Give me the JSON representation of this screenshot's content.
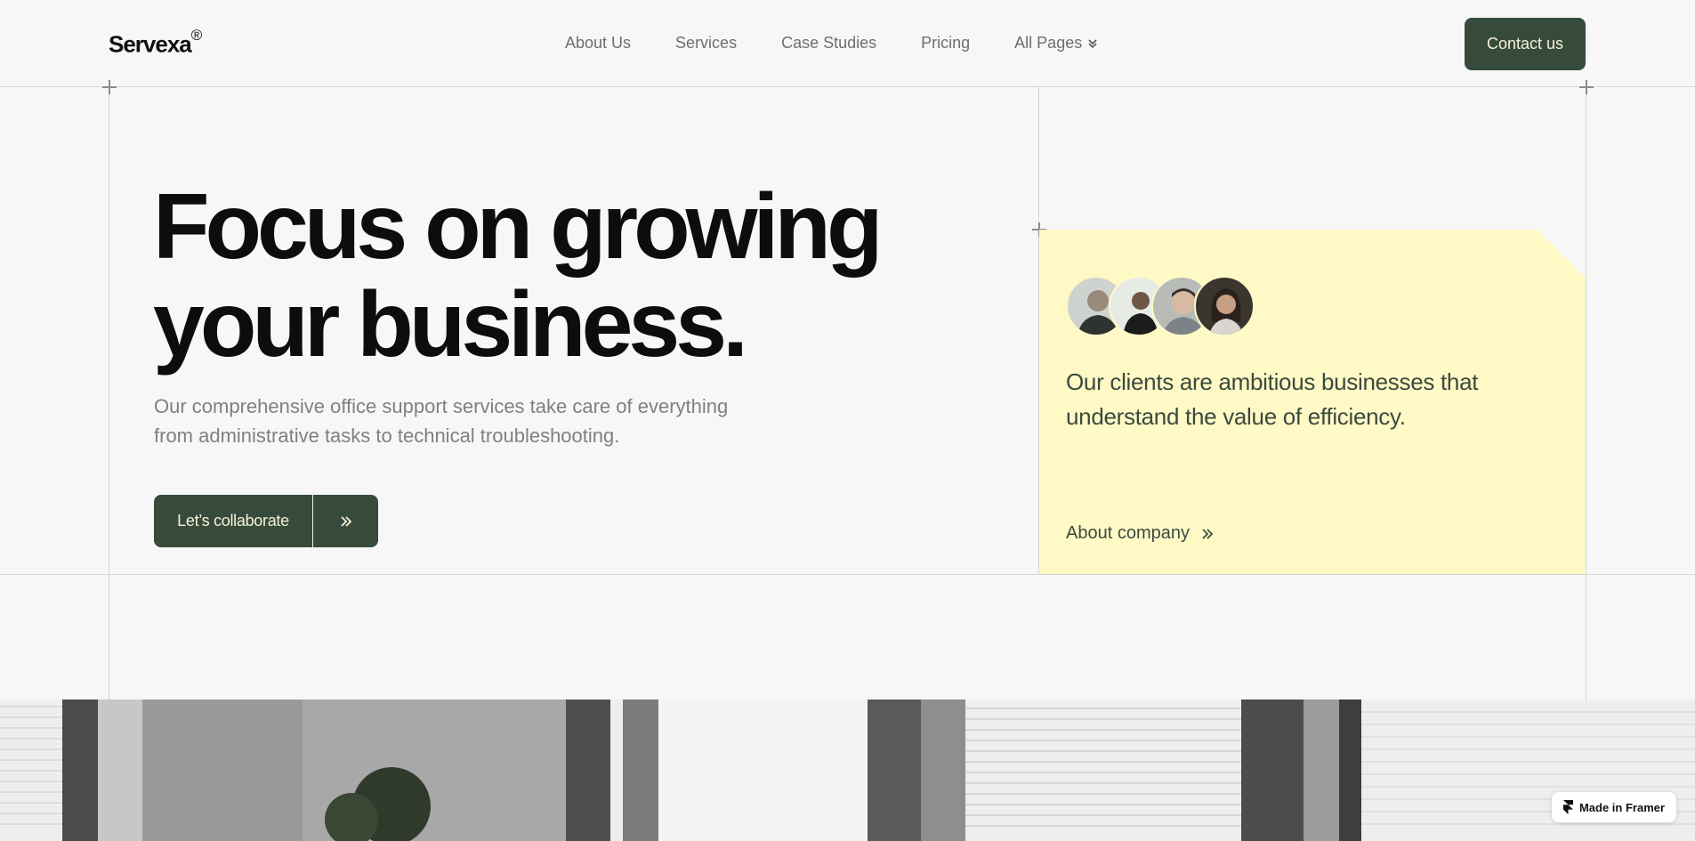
{
  "header": {
    "logo": "Servexa",
    "logo_mark": "®",
    "nav": [
      {
        "label": "About Us"
      },
      {
        "label": "Services"
      },
      {
        "label": "Case Studies"
      },
      {
        "label": "Pricing"
      },
      {
        "label": "All Pages"
      }
    ],
    "contact_label": "Contact us"
  },
  "hero": {
    "title_line1": "Focus on growing",
    "title_line2": "your business.",
    "subtitle_line1": "Our comprehensive office support services take care of everything",
    "subtitle_line2": "from administrative tasks to technical troubleshooting.",
    "cta_label": "Let’s collaborate"
  },
  "card": {
    "text_line1": "Our clients are ambitious businesses that",
    "text_line2": "understand the value of efficiency.",
    "link_label": "About company"
  },
  "badge": {
    "label": "Made in Framer"
  },
  "colors": {
    "accent": "#374b3c",
    "card_bg": "#fff9c6",
    "page_bg": "#f7f7f7"
  }
}
